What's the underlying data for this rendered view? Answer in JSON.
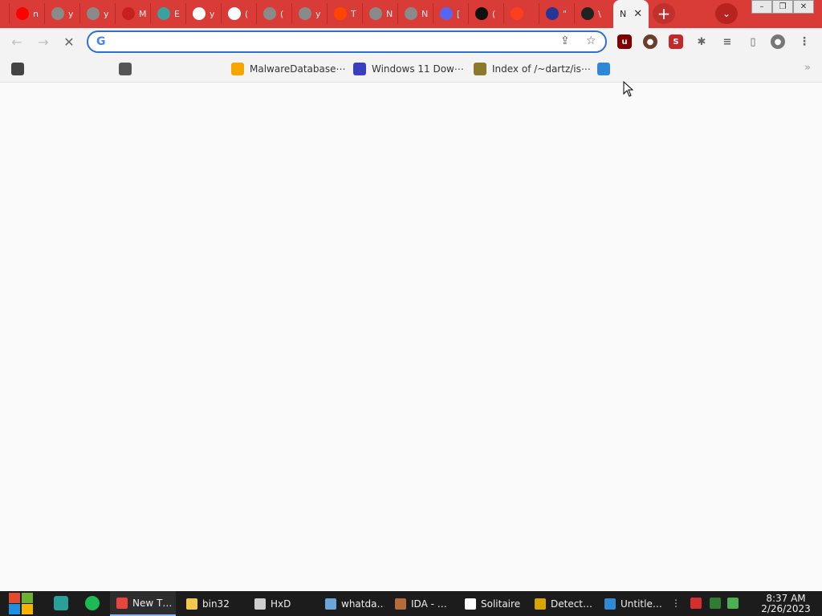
{
  "tabs": [
    {
      "icon": "youtube-icon",
      "cut": "n",
      "color": "#ff0000"
    },
    {
      "icon": "globe-icon",
      "cut": "y",
      "color": "#8a8a8a"
    },
    {
      "icon": "globe-icon",
      "cut": "y",
      "color": "#8a8a8a"
    },
    {
      "icon": "gmail-icon",
      "cut": "M",
      "color": "#c5221f"
    },
    {
      "icon": "game-icon",
      "cut": "E",
      "color": "#3aa0a0"
    },
    {
      "icon": "google-icon",
      "cut": "y",
      "color": "#ffffff"
    },
    {
      "icon": "google-icon",
      "cut": "(",
      "color": "#ffffff"
    },
    {
      "icon": "globe-icon",
      "cut": "(",
      "color": "#8a8a8a"
    },
    {
      "icon": "globe-icon",
      "cut": "y",
      "color": "#8a8a8a"
    },
    {
      "icon": "reddit-icon",
      "cut": "T",
      "color": "#ff4500"
    },
    {
      "icon": "globe-icon",
      "cut": "N",
      "color": "#8a8a8a"
    },
    {
      "icon": "globe-icon",
      "cut": "N",
      "color": "#8a8a8a"
    },
    {
      "icon": "discord-icon",
      "cut": "[",
      "color": "#5865f2"
    },
    {
      "icon": "github-icon",
      "cut": "(",
      "color": "#111111"
    },
    {
      "icon": "yandex-icon",
      "cut": "",
      "color": "#fc3f1d"
    },
    {
      "icon": "twenty-icon",
      "cut": "\"",
      "color": "#283593"
    },
    {
      "icon": "archive-icon",
      "cut": "\\",
      "color": "#222222"
    }
  ],
  "active_tab": {
    "label": "N",
    "close": "✕"
  },
  "window": {
    "minimize": "–",
    "restore": "❐",
    "close": "✕"
  },
  "omnibox": {
    "value": "",
    "placeholder": ""
  },
  "bookmarks": [
    {
      "label": "",
      "icon": "sticker-icon",
      "color": "#444"
    },
    {
      "label": "",
      "icon": "globe-icon",
      "color": "#555"
    },
    {
      "label": "MalwareDatabase⋯",
      "icon": "ph-icon",
      "color": "#f7a600"
    },
    {
      "label": "Windows 11 Dow⋯",
      "icon": "x-icon",
      "color": "#3a3fbf"
    },
    {
      "label": "Index of /~dartz/is⋯",
      "icon": "figure-icon",
      "color": "#8a7a2a"
    },
    {
      "label": "",
      "icon": "doc-icon",
      "color": "#2f88d6"
    }
  ],
  "taskbar": {
    "buttons": [
      {
        "label": "New T…",
        "icon": "chrome-icon",
        "color": "#e8453c"
      },
      {
        "label": "bin32",
        "icon": "folder-icon",
        "color": "#f2c94c"
      },
      {
        "label": "HxD",
        "icon": "hxd-icon",
        "color": "#cfcfcf"
      },
      {
        "label": "whatda…",
        "icon": "picture-icon",
        "color": "#6aa6d8"
      },
      {
        "label": "IDA - …",
        "icon": "ida-icon",
        "color": "#b56b3a"
      },
      {
        "label": "Solitaire",
        "icon": "cards-icon",
        "color": "#ffffff"
      },
      {
        "label": "Detect…",
        "icon": "detect-icon",
        "color": "#d9a400"
      },
      {
        "label": "Untitle…",
        "icon": "vscode-icon",
        "color": "#2f8ad8"
      }
    ],
    "time": "8:37 AM",
    "date": "2/26/2023"
  }
}
